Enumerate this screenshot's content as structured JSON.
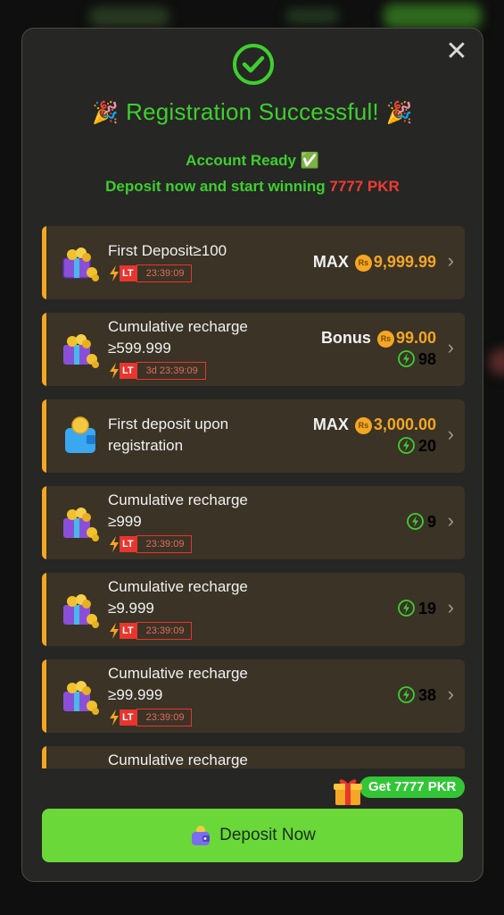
{
  "modal": {
    "title": "Registration Successful!",
    "account_ready": "Account Ready ✅",
    "deposit_prefix": "Deposit now and start winning",
    "deposit_amount": "7777 PKR"
  },
  "rewards": [
    {
      "name_line1": "First Deposit≥100",
      "name_line2": "",
      "lt_label": "LT",
      "timer": "23:39:09",
      "right_label": "MAX",
      "currency": "Rs",
      "amount": "9,999.99",
      "bonus_points": "",
      "icon": "gift-box-icon"
    },
    {
      "name_line1": "Cumulative recharge",
      "name_line2": "≥599.999",
      "lt_label": "LT",
      "timer": "3d 23:39:09",
      "right_label": "Bonus",
      "currency": "Rs",
      "amount": "99.00",
      "bonus_points": "98",
      "icon": "gift-box-icon"
    },
    {
      "name_line1": "First deposit upon",
      "name_line2": "registration",
      "lt_label": "",
      "timer": "",
      "right_label": "MAX",
      "currency": "Rs",
      "amount": "3,000.00",
      "bonus_points": "20",
      "icon": "wallet-coin-icon"
    },
    {
      "name_line1": "Cumulative recharge",
      "name_line2": "≥999",
      "lt_label": "LT",
      "timer": "23:39:09",
      "right_label": "",
      "currency": "",
      "amount": "",
      "bonus_points": "9",
      "icon": "gift-box-icon"
    },
    {
      "name_line1": "Cumulative recharge",
      "name_line2": "≥9.999",
      "lt_label": "LT",
      "timer": "23:39:09",
      "right_label": "",
      "currency": "",
      "amount": "",
      "bonus_points": "19",
      "icon": "gift-box-icon"
    },
    {
      "name_line1": "Cumulative recharge",
      "name_line2": "≥99.999",
      "lt_label": "LT",
      "timer": "23:39:09",
      "right_label": "",
      "currency": "",
      "amount": "",
      "bonus_points": "38",
      "icon": "gift-box-icon"
    },
    {
      "name_line1": "Cumulative recharge",
      "name_line2": "",
      "lt_label": "",
      "timer": "",
      "right_label": "",
      "currency": "",
      "amount": "",
      "bonus_points": "",
      "icon": "gift-box-icon"
    }
  ],
  "gift_badge": {
    "label": "Get 7777 PKR"
  },
  "deposit_button": {
    "label": "Deposit Now"
  },
  "colors": {
    "accent_green": "#3ecf2f",
    "accent_orange": "#f5a623",
    "alert_red": "#ef3b36",
    "button_green": "#6bd83a"
  }
}
